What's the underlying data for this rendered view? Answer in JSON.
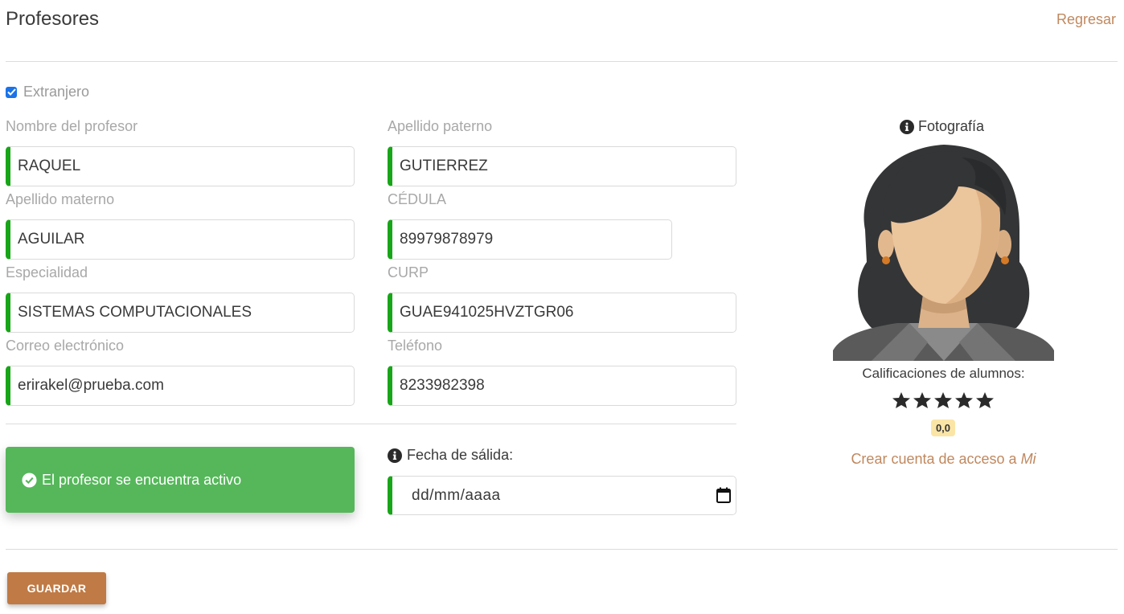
{
  "header": {
    "title": "Profesores",
    "back_link": "Regresar"
  },
  "foreign_checkbox": {
    "label": "Extranjero",
    "checked": true
  },
  "form": {
    "first_name": {
      "label": "Nombre del profesor",
      "value": "RAQUEL"
    },
    "paternal_last_name": {
      "label": "Apellido paterno",
      "value": "GUTIERREZ"
    },
    "maternal_last_name": {
      "label": "Apellido materno",
      "value": "AGUILAR"
    },
    "cedula": {
      "label": "CÉDULA",
      "value": "89979878979"
    },
    "specialty": {
      "label": "Especialidad",
      "value": "SISTEMAS COMPUTACIONALES"
    },
    "curp": {
      "label": "CURP",
      "value": "GUAE941025HVZTGR06"
    },
    "email": {
      "label": "Correo electrónico",
      "value": "erirakel@prueba.com"
    },
    "phone": {
      "label": "Teléfono",
      "value": "8233982398"
    }
  },
  "status": {
    "text": "El profesor se encuentra activo",
    "color": "#55b75a"
  },
  "exit_date": {
    "label": "Fecha de sálida:",
    "placeholder": "dd/mm/aaaa"
  },
  "photo": {
    "label": "Fotografía"
  },
  "ratings": {
    "label": "Calificaciones de alumnos:",
    "stars": 5,
    "score": "0,0"
  },
  "account_link": {
    "text": "Crear cuenta de acceso a ",
    "emphasis": "Mi"
  },
  "actions": {
    "save": "GUARDAR"
  },
  "colors": {
    "accent": "#c07a45",
    "link": "#c0885e",
    "valid_border": "#19a519"
  }
}
